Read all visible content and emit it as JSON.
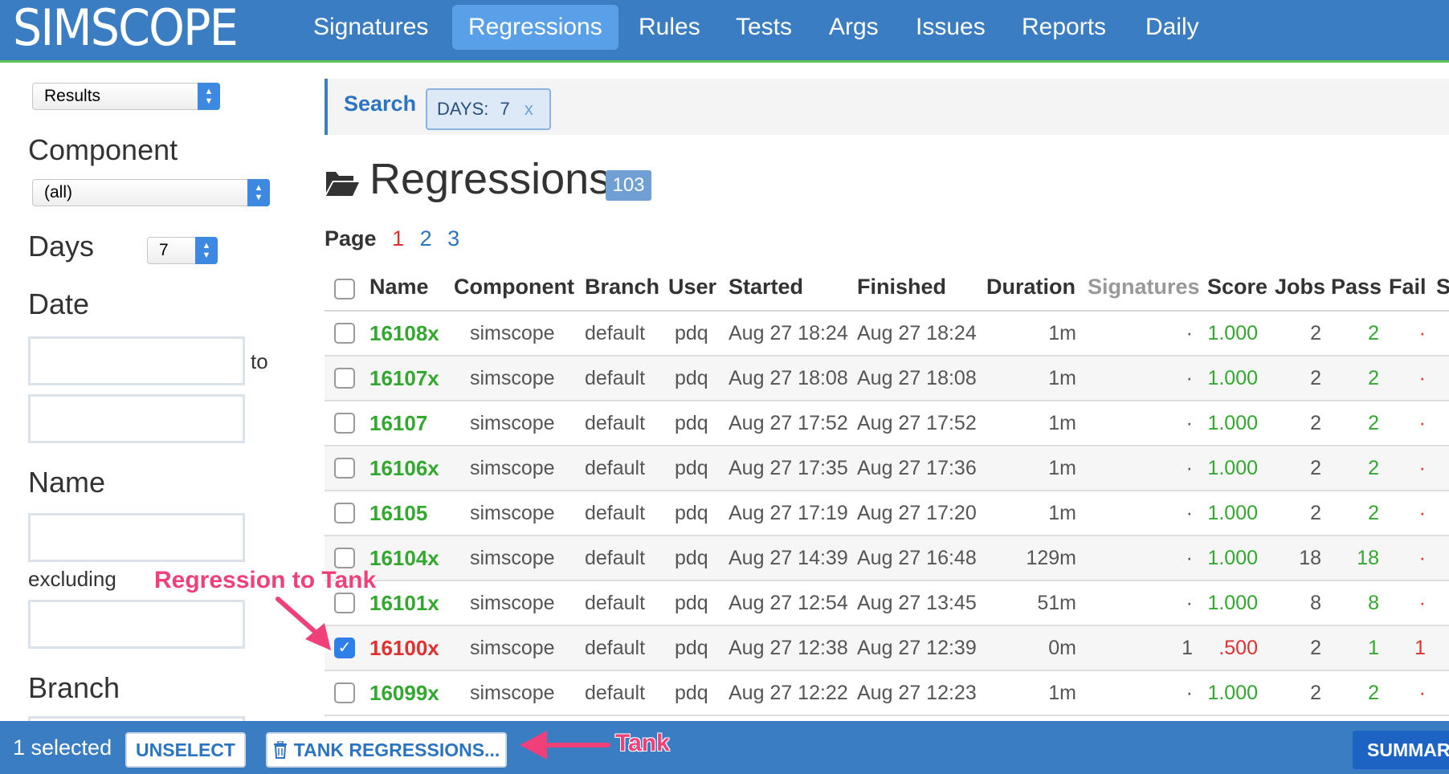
{
  "app": {
    "logo": "SIMSCOPE"
  },
  "nav": [
    {
      "label": "Signatures",
      "active": false
    },
    {
      "label": "Regressions",
      "active": true
    },
    {
      "label": "Rules",
      "active": false
    },
    {
      "label": "Tests",
      "active": false
    },
    {
      "label": "Args",
      "active": false
    },
    {
      "label": "Issues",
      "active": false
    },
    {
      "label": "Reports",
      "active": false
    },
    {
      "label": "Daily",
      "active": false
    }
  ],
  "sidebar": {
    "view_select": "Results",
    "component_label": "Component",
    "component_select": "(all)",
    "days_label": "Days",
    "days_select": "7",
    "date_label": "Date",
    "date_to": "to",
    "name_label": "Name",
    "excluding_label": "excluding",
    "branch_label": "Branch"
  },
  "search": {
    "label": "Search",
    "chip_key": "DAYS:",
    "chip_value": "7",
    "chip_remove": "x"
  },
  "main": {
    "title": "Regressions",
    "count": "103",
    "page_label": "Page",
    "pages": [
      "1",
      "2",
      "3"
    ],
    "current_page": "1"
  },
  "table": {
    "headers": {
      "name": "Name",
      "component": "Component",
      "branch": "Branch",
      "user": "User",
      "started": "Started",
      "finished": "Finished",
      "duration": "Duration",
      "signatures": "Signatures",
      "score": "Score",
      "jobs": "Jobs",
      "pass": "Pass",
      "fail": "Fail",
      "extra": "S"
    },
    "rows": [
      {
        "name": "16108x",
        "component": "simscope",
        "branch": "default",
        "user": "pdq",
        "started": "Aug 27 18:24",
        "finished": "Aug 27 18:24",
        "duration": "1m",
        "signatures": "·",
        "score": "1.000",
        "jobs": "2",
        "pass": "2",
        "fail": "·",
        "checked": false
      },
      {
        "name": "16107x",
        "component": "simscope",
        "branch": "default",
        "user": "pdq",
        "started": "Aug 27 18:08",
        "finished": "Aug 27 18:08",
        "duration": "1m",
        "signatures": "·",
        "score": "1.000",
        "jobs": "2",
        "pass": "2",
        "fail": "·",
        "checked": false
      },
      {
        "name": "16107",
        "component": "simscope",
        "branch": "default",
        "user": "pdq",
        "started": "Aug 27 17:52",
        "finished": "Aug 27 17:52",
        "duration": "1m",
        "signatures": "·",
        "score": "1.000",
        "jobs": "2",
        "pass": "2",
        "fail": "·",
        "checked": false
      },
      {
        "name": "16106x",
        "component": "simscope",
        "branch": "default",
        "user": "pdq",
        "started": "Aug 27 17:35",
        "finished": "Aug 27 17:36",
        "duration": "1m",
        "signatures": "·",
        "score": "1.000",
        "jobs": "2",
        "pass": "2",
        "fail": "·",
        "checked": false
      },
      {
        "name": "16105",
        "component": "simscope",
        "branch": "default",
        "user": "pdq",
        "started": "Aug 27 17:19",
        "finished": "Aug 27 17:20",
        "duration": "1m",
        "signatures": "·",
        "score": "1.000",
        "jobs": "2",
        "pass": "2",
        "fail": "·",
        "checked": false
      },
      {
        "name": "16104x",
        "component": "simscope",
        "branch": "default",
        "user": "pdq",
        "started": "Aug 27 14:39",
        "finished": "Aug 27 16:48",
        "duration": "129m",
        "signatures": "·",
        "score": "1.000",
        "jobs": "18",
        "pass": "18",
        "fail": "·",
        "checked": false
      },
      {
        "name": "16101x",
        "component": "simscope",
        "branch": "default",
        "user": "pdq",
        "started": "Aug 27 12:54",
        "finished": "Aug 27 13:45",
        "duration": "51m",
        "signatures": "·",
        "score": "1.000",
        "jobs": "8",
        "pass": "8",
        "fail": "·",
        "checked": false
      },
      {
        "name": "16100x",
        "component": "simscope",
        "branch": "default",
        "user": "pdq",
        "started": "Aug 27 12:38",
        "finished": "Aug 27 12:39",
        "duration": "0m",
        "signatures": "1",
        "score": ".500",
        "jobs": "2",
        "pass": "1",
        "fail": "1",
        "checked": true
      },
      {
        "name": "16099x",
        "component": "simscope",
        "branch": "default",
        "user": "pdq",
        "started": "Aug 27 12:22",
        "finished": "Aug 27 12:23",
        "duration": "1m",
        "signatures": "·",
        "score": "1.000",
        "jobs": "2",
        "pass": "2",
        "fail": "·",
        "checked": false
      }
    ]
  },
  "bottombar": {
    "selected_text": "1 selected",
    "unselect_label": "UNSELECT",
    "tank_label": "TANK REGRESSIONS...",
    "summary_label": "SUMMAR"
  },
  "annotations": {
    "regression_to_tank": "Regression to Tank",
    "tank": "Tank",
    "color": "#f0407a"
  },
  "colors": {
    "nav_bg": "#3b7dc2",
    "nav_active": "#5aa0e8",
    "pass_green": "#32a82f",
    "fail_red": "#e0302f",
    "link_blue": "#2a74c2"
  }
}
